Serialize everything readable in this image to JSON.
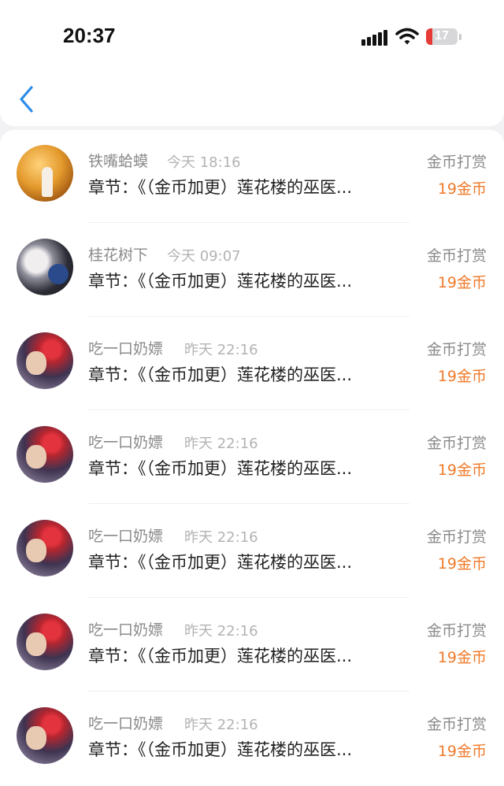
{
  "status_bar": {
    "time": "20:37",
    "battery": "17",
    "icons": [
      "signal-icon",
      "wifi-icon",
      "battery-icon"
    ]
  },
  "nav": {
    "back_icon": "chevron-left-icon"
  },
  "colors": {
    "accent": "#2a8cea",
    "amount": "#f07a2a",
    "battery_low": "#e63a36"
  },
  "rows": [
    {
      "name": "铁嘴蛤蟆",
      "time": "今天 18:16",
      "kind": "金币打赏",
      "chapter": "章节：《（金币加更）莲花楼的巫医...",
      "amount": "19金币"
    },
    {
      "name": "桂花树下",
      "time": "今天 09:07",
      "kind": "金币打赏",
      "chapter": "章节：《（金币加更）莲花楼的巫医...",
      "amount": "19金币"
    },
    {
      "name": "吃一口奶嫖",
      "time": "昨天 22:16",
      "kind": "金币打赏",
      "chapter": "章节：《（金币加更）莲花楼的巫医...",
      "amount": "19金币"
    },
    {
      "name": "吃一口奶嫖",
      "time": "昨天 22:16",
      "kind": "金币打赏",
      "chapter": "章节：《（金币加更）莲花楼的巫医...",
      "amount": "19金币"
    },
    {
      "name": "吃一口奶嫖",
      "time": "昨天 22:16",
      "kind": "金币打赏",
      "chapter": "章节：《（金币加更）莲花楼的巫医...",
      "amount": "19金币"
    },
    {
      "name": "吃一口奶嫖",
      "time": "昨天 22:16",
      "kind": "金币打赏",
      "chapter": "章节：《（金币加更）莲花楼的巫医...",
      "amount": "19金币"
    },
    {
      "name": "吃一口奶嫖",
      "time": "昨天 22:16",
      "kind": "金币打赏",
      "chapter": "章节：《（金币加更）莲花楼的巫医...",
      "amount": "19金币"
    }
  ]
}
